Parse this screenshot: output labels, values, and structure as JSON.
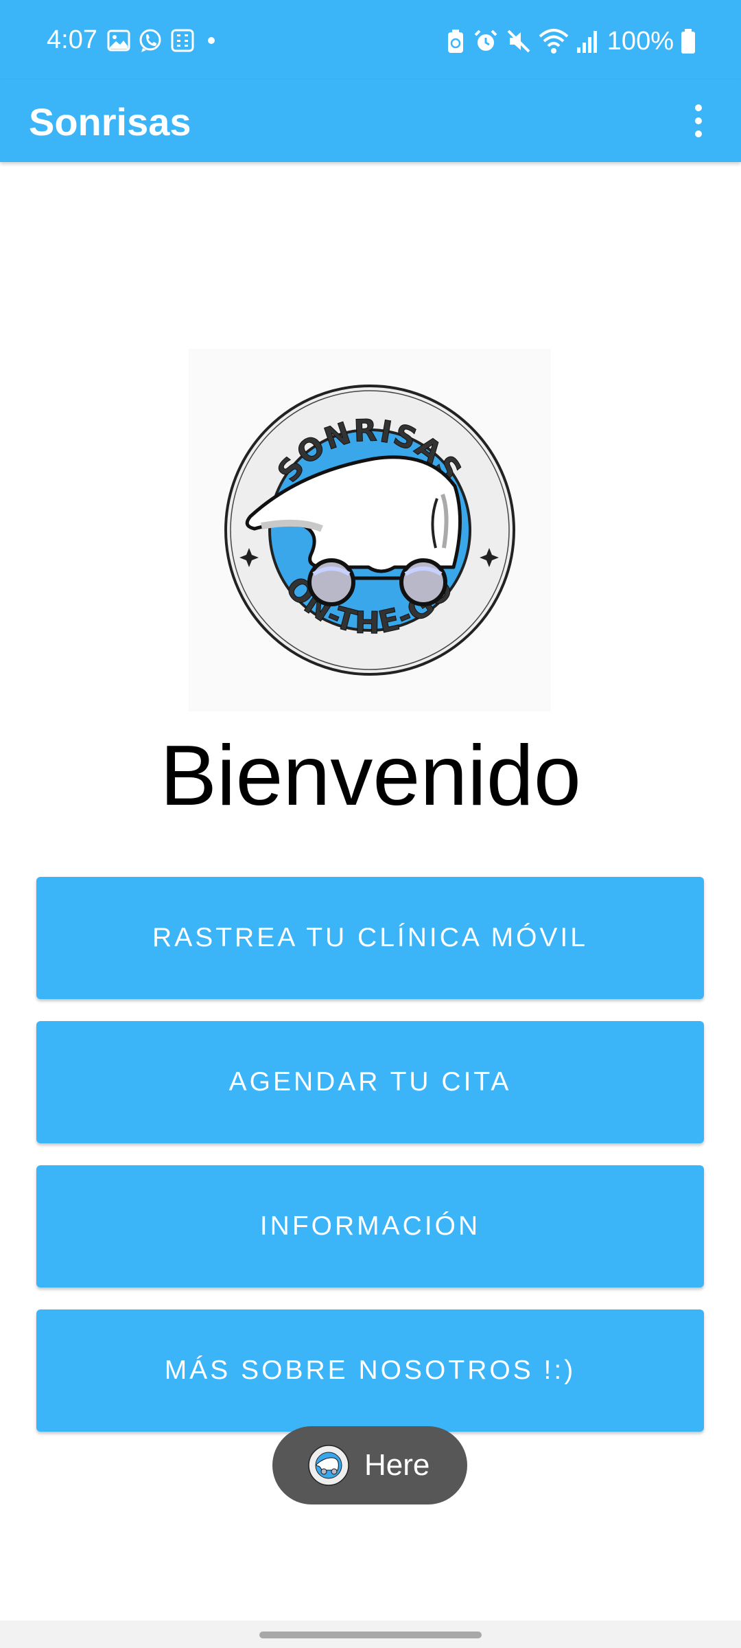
{
  "status_bar": {
    "time": "4:07",
    "battery": "100%",
    "left_icons": [
      "gallery-icon",
      "whatsapp-icon",
      "calculator-icon",
      "notification-dot-icon"
    ],
    "right_icons": [
      "battery-saver-icon",
      "alarm-icon",
      "mute-icon",
      "wifi-icon",
      "signal-icon",
      "battery-icon"
    ]
  },
  "app_bar": {
    "title": "Sonrisas",
    "menu_icon": "more-vert-icon"
  },
  "logo": {
    "text_top": "SONRISAS",
    "text_bottom": "ON-THE-GO"
  },
  "main": {
    "welcome": "Bienvenido",
    "buttons": [
      {
        "label": "RASTREA TU CLÍNICA MÓVIL"
      },
      {
        "label": "AGENDAR TU CITA"
      },
      {
        "label": "INFORMACIÓN"
      },
      {
        "label": "MÁS SOBRE NOSOTROS !:)"
      }
    ]
  },
  "toast": {
    "text": "Here"
  },
  "colors": {
    "primary": "#3bb4f8",
    "toast_bg": "#575757",
    "logo_blue": "#3aa7ea"
  }
}
